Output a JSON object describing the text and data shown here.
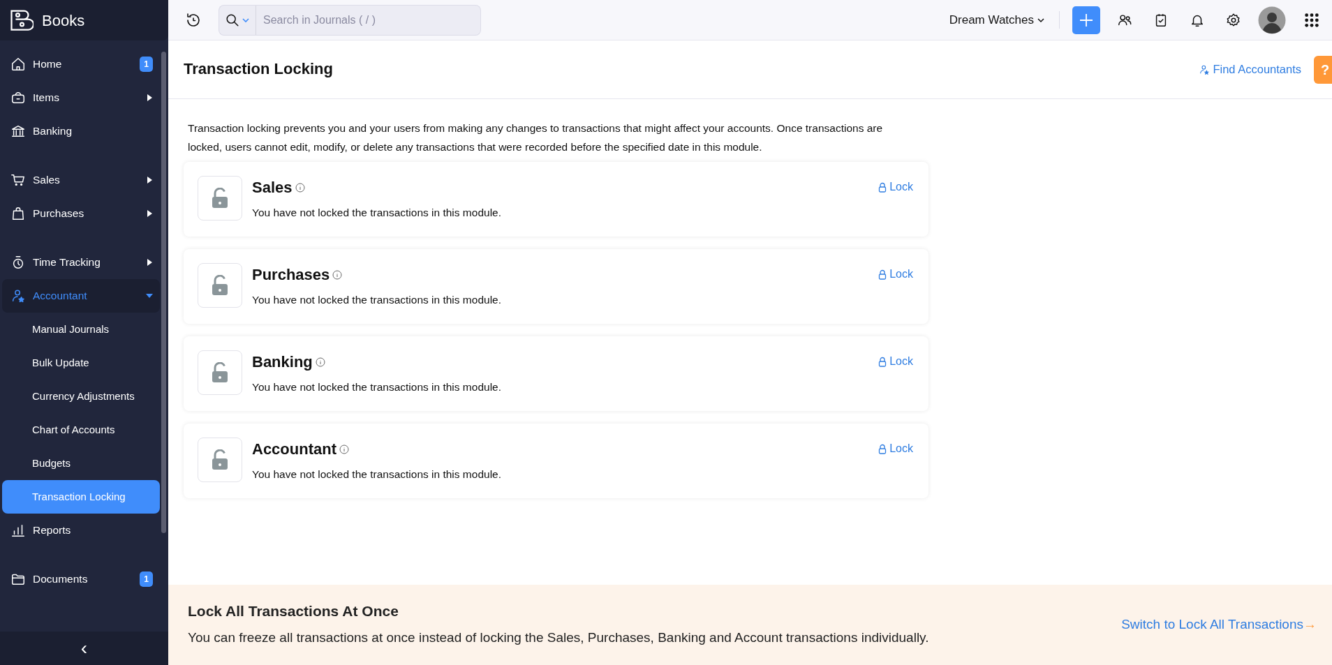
{
  "app": {
    "name": "Books"
  },
  "sidebar": {
    "sections": [
      [
        {
          "label": "Home",
          "kind": "link",
          "selected": false,
          "badge": "1"
        },
        {
          "label": "Items",
          "kind": "menu",
          "selected": false,
          "expanded": false
        },
        {
          "label": "Banking",
          "kind": "link",
          "selected": false
        }
      ],
      [
        {
          "label": "Sales",
          "kind": "menu",
          "selected": false,
          "expanded": false
        },
        {
          "label": "Purchases",
          "kind": "menu",
          "selected": false,
          "expanded": false
        }
      ],
      [
        {
          "label": "Time Tracking",
          "kind": "menu",
          "selected": false,
          "expanded": false
        },
        {
          "label": "Accountant",
          "kind": "menu",
          "selected": true,
          "expanded": true,
          "children": [
            {
              "label": "Manual Journals",
              "selected": false
            },
            {
              "label": "Bulk Update",
              "selected": false
            },
            {
              "label": "Currency Adjustments",
              "selected": false
            },
            {
              "label": "Chart of Accounts",
              "selected": false
            },
            {
              "label": "Budgets",
              "selected": false
            },
            {
              "label": "Transaction Locking",
              "selected": true
            }
          ]
        },
        {
          "label": "Reports",
          "kind": "link",
          "selected": false
        }
      ],
      [
        {
          "label": "Documents",
          "kind": "link",
          "selected": false,
          "badge": "1"
        }
      ]
    ],
    "collapse": "‹"
  },
  "topbar": {
    "search": {
      "placeholder": "Search in Journals ( / )"
    },
    "organization": "Dream Watches"
  },
  "header": {
    "title": "Transaction Locking",
    "link": "Find Accountants",
    "help": "?"
  },
  "intro": "Transaction locking prevents you and your users from making any changes to transactions that might affect your accounts. Once transactions are locked, users cannot edit, modify, or delete any transactions that were recorded before the specified date in this module.",
  "modules": [
    {
      "name": "Sales",
      "status": "You have not locked the transactions in this module.",
      "action": "Lock",
      "locked": false
    },
    {
      "name": "Purchases",
      "status": "You have not locked the transactions in this module.",
      "action": "Lock",
      "locked": false
    },
    {
      "name": "Banking",
      "status": "You have not locked the transactions in this module.",
      "action": "Lock",
      "locked": false
    },
    {
      "name": "Accountant",
      "status": "You have not locked the transactions in this module.",
      "action": "Lock",
      "locked": false
    }
  ],
  "banner": {
    "title": "Lock All Transactions At Once",
    "text": "You can freeze all transactions at once instead of locking the Sales, Purchases, Banking and Account transactions individually.",
    "link": "Switch to Lock All Transactions",
    "arrow": "→"
  }
}
